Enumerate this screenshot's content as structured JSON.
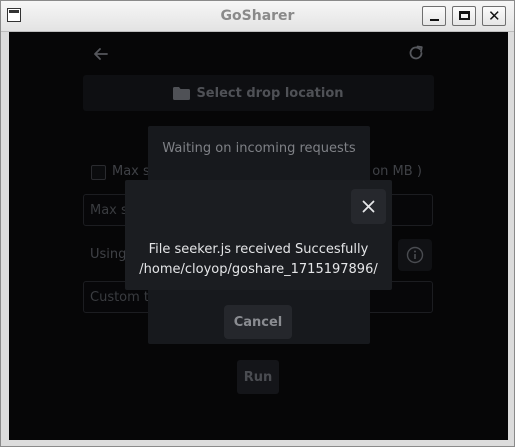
{
  "window": {
    "title": "GoSharer"
  },
  "app": {
    "drop_location_label": "Select drop location",
    "max_size_checkbox_label_start": "Max s",
    "max_size_checkbox_label_end": "t on MB )",
    "max_size_input_placeholder": "Max s",
    "using_label": "Using",
    "custom_input_placeholder": "Custom t",
    "run_label": "Run"
  },
  "waiting_dialog": {
    "title": "Waiting on incoming requests",
    "cancel_label": "Cancel"
  },
  "success_dialog": {
    "line1": "File seeker.js received Succesfully",
    "line2": "/home/cloyop/goshare_1715197896/"
  }
}
